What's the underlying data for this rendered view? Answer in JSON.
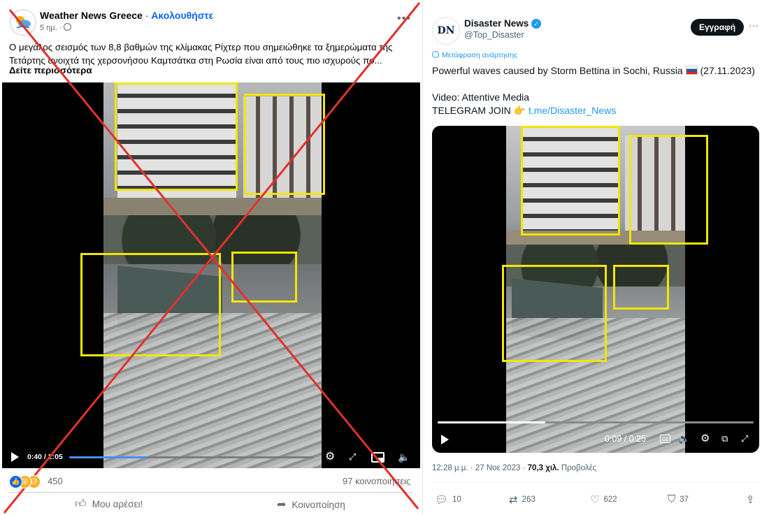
{
  "facebook_post": {
    "page_name": "Weather News Greece",
    "separator": " · ",
    "follow_label": "Ακολουθήστε",
    "time_ago": "5 ημ. · ",
    "privacy_icon": "globe-icon",
    "caption": "Ο μεγάλος σεισμός των 8,8 βαθμών της κλίμακας Ρίχτερ που σημειώθηκε τα ξημερώματα της Τετάρτης ανοιχτά της χερσονήσου Καμτσάτκα στη Ρωσία είναι από τους πιο ισχυρούς πο...",
    "see_more": "Δείτε περισσότερα",
    "video": {
      "time": "0:40 / 2:05",
      "progress": 0.32
    },
    "reactions_count": "450",
    "shares": "97 κοινοποιήσεις",
    "like_label": "Μου αρέσει!",
    "share_label": "Κοινοποίηση",
    "marked_false": true,
    "cross_color": "#e0322c"
  },
  "tweet": {
    "avatar_text": "DN",
    "display_name": "Disaster News",
    "handle": "@Top_Disaster",
    "subscribe_label": "Εγγραφή",
    "translate_label": "Μετάφραση ανάρτησης",
    "line1_before": "Powerful waves caused by Storm Bettina in Sochi, Russia ",
    "line1_after": " (27.11.2023)",
    "line2": "Video: Attentive Media",
    "line3_prefix": "TELEGRAM JOIN ",
    "emoji": "👉",
    "link": "t.me/Disaster_News",
    "video": {
      "time": "0:09 / 0:25",
      "progress": 0.34
    },
    "timestamp": "12:28 μ.μ. · 27 Νοε 2023 · ",
    "views": "70,3 χιλ.",
    "views_label": " Προβολές",
    "stats": {
      "replies": "10",
      "reposts": "263",
      "likes": "622",
      "bookmarks": "37"
    }
  },
  "colors": {
    "highlight_box": "#f2e600",
    "facebook_blue": "#0866ff",
    "x_blue": "#1d9bf0"
  }
}
